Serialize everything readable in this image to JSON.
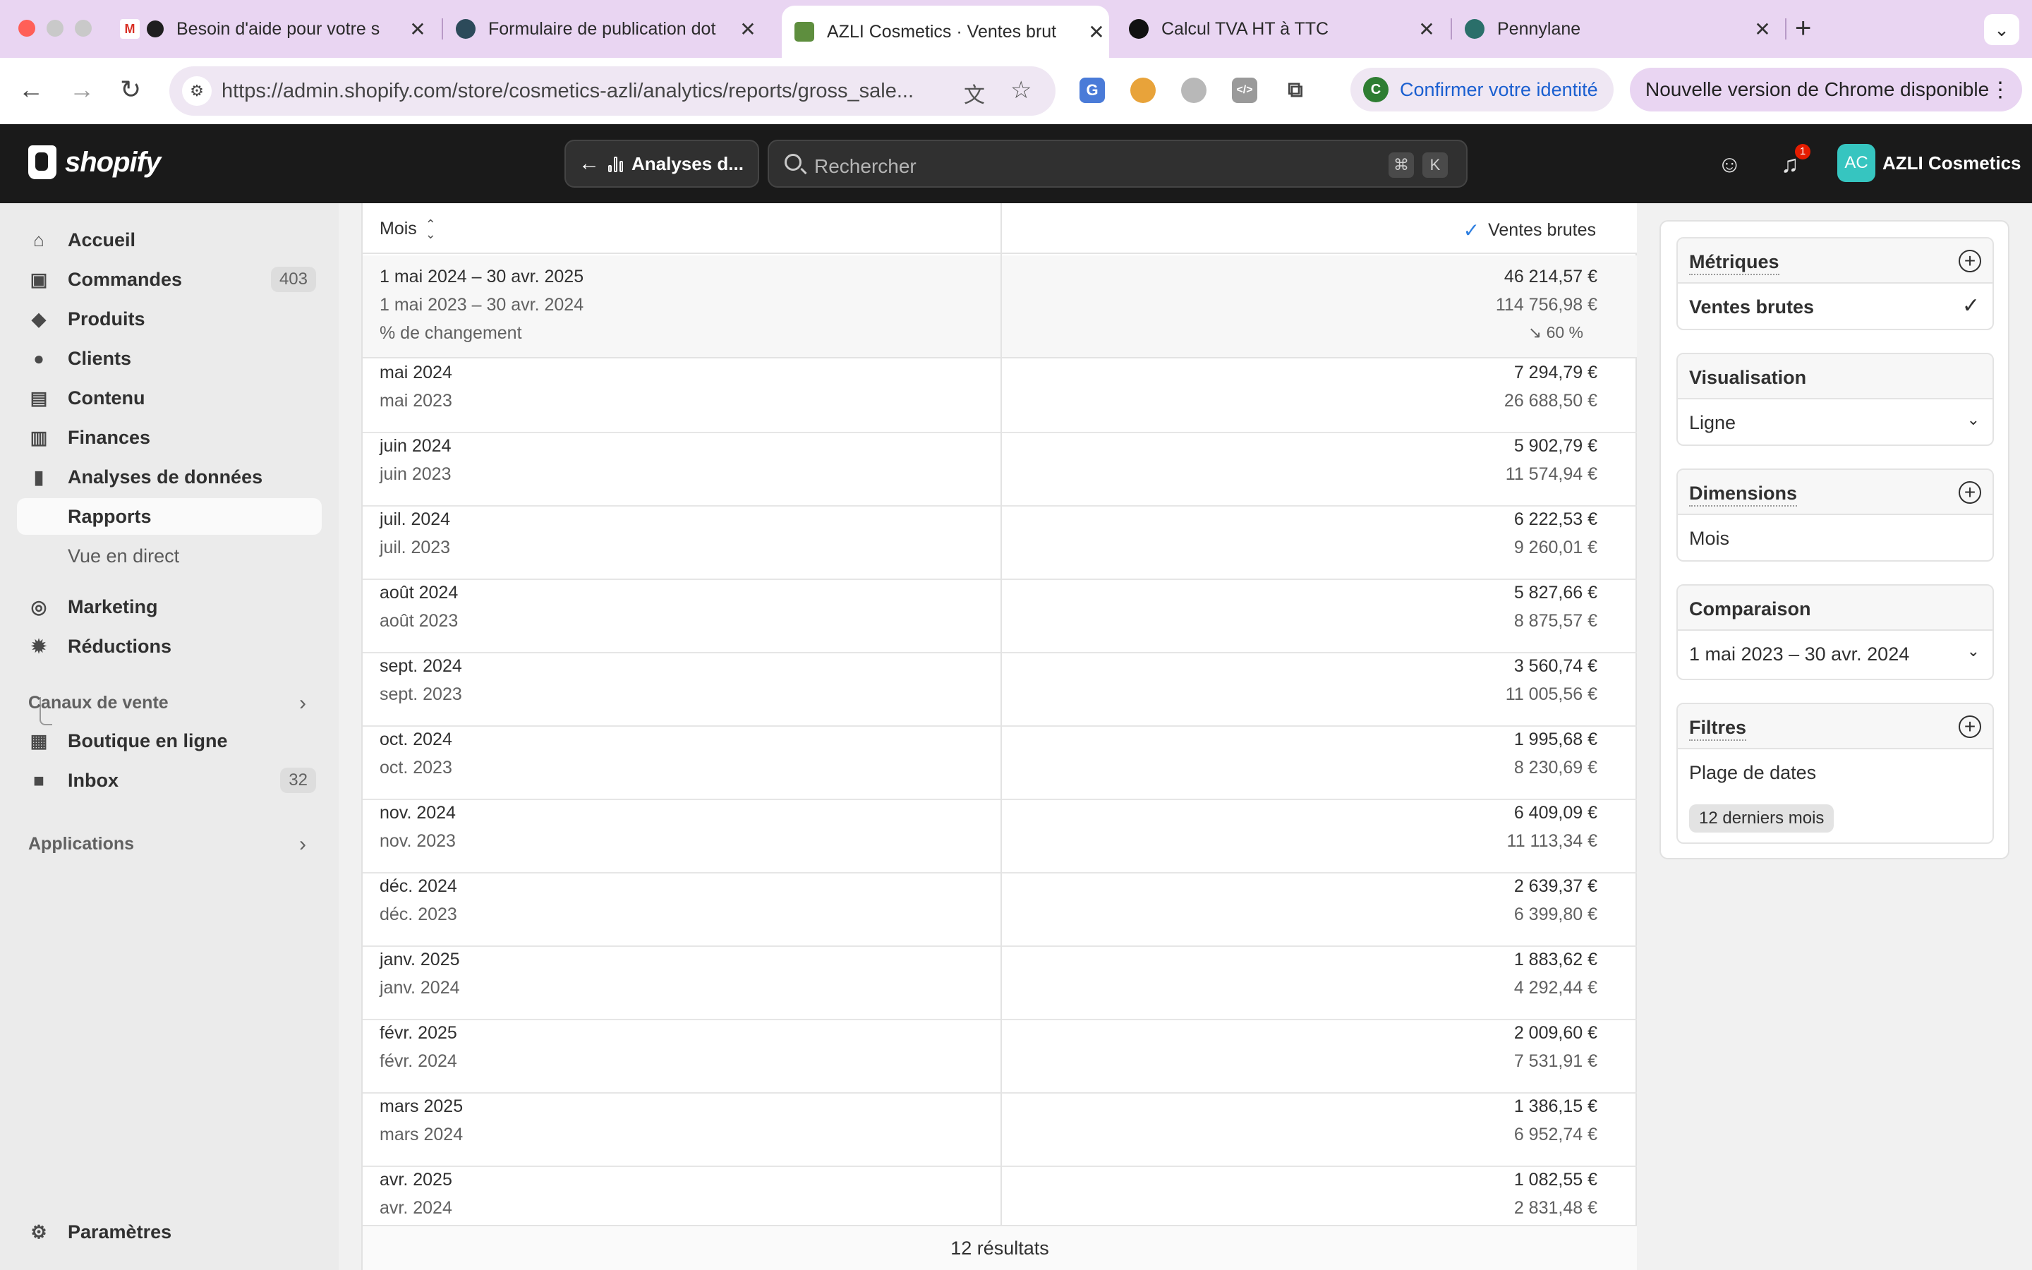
{
  "browser": {
    "tabs": [
      {
        "label": "Besoin d'aide pour votre s",
        "close": "✕"
      },
      {
        "label": "Formulaire de publication dot",
        "close": "✕"
      },
      {
        "label": "AZLI Cosmetics · Ventes brut",
        "close": "✕"
      },
      {
        "label": "Calcul TVA HT à TTC",
        "close": "✕"
      },
      {
        "label": "Pennylane",
        "close": "✕"
      }
    ],
    "new_tab": "+",
    "url": "https://admin.shopify.com/store/cosmetics-azli/analytics/reports/gross_sale...",
    "confirm_identity": "Confirmer votre identité",
    "update_notice": "Nouvelle version de Chrome disponible",
    "profile_initial": "C"
  },
  "shopify": {
    "logo_text": "shopify",
    "back_label": "Analyses d...",
    "search_placeholder": "Rechercher",
    "kbd_cmd": "⌘",
    "kbd_k": "K",
    "notification_count": "1",
    "avatar_initials": "AC",
    "store_name": "AZLI Cosmetics"
  },
  "sidebar": {
    "items": [
      {
        "label": "Accueil"
      },
      {
        "label": "Commandes",
        "count": "403"
      },
      {
        "label": "Produits"
      },
      {
        "label": "Clients"
      },
      {
        "label": "Contenu"
      },
      {
        "label": "Finances"
      },
      {
        "label": "Analyses de données"
      },
      {
        "label": "Rapports"
      },
      {
        "label": "Vue en direct"
      },
      {
        "label": "Marketing"
      },
      {
        "label": "Réductions"
      }
    ],
    "sales_channels_title": "Canaux de vente",
    "channels": [
      {
        "label": "Boutique en ligne"
      },
      {
        "label": "Inbox",
        "count": "32"
      }
    ],
    "apps_title": "Applications",
    "settings_label": "Paramètres"
  },
  "report": {
    "col_month": "Mois",
    "col_metric": "Ventes brutes",
    "summary": {
      "period_current": "1 mai 2024 – 30 avr. 2025",
      "period_previous": "1 mai 2023 – 30 avr. 2024",
      "change_label": "% de changement",
      "total_current": "46 214,57 €",
      "total_previous": "114 756,98 €",
      "change_value": "↘ 60 %"
    },
    "rows": [
      {
        "month": "mai 2024",
        "month_prev": "mai 2023",
        "value": "7 294,79 €",
        "value_prev": "26 688,50 €"
      },
      {
        "month": "juin 2024",
        "month_prev": "juin 2023",
        "value": "5 902,79 €",
        "value_prev": "11 574,94 €"
      },
      {
        "month": "juil. 2024",
        "month_prev": "juil. 2023",
        "value": "6 222,53 €",
        "value_prev": "9 260,01 €"
      },
      {
        "month": "août 2024",
        "month_prev": "août 2023",
        "value": "5 827,66 €",
        "value_prev": "8 875,57 €"
      },
      {
        "month": "sept. 2024",
        "month_prev": "sept. 2023",
        "value": "3 560,74 €",
        "value_prev": "11 005,56 €"
      },
      {
        "month": "oct. 2024",
        "month_prev": "oct. 2023",
        "value": "1 995,68 €",
        "value_prev": "8 230,69 €"
      },
      {
        "month": "nov. 2024",
        "month_prev": "nov. 2023",
        "value": "6 409,09 €",
        "value_prev": "11 113,34 €"
      },
      {
        "month": "déc. 2024",
        "month_prev": "déc. 2023",
        "value": "2 639,37 €",
        "value_prev": "6 399,80 €"
      },
      {
        "month": "janv. 2025",
        "month_prev": "janv. 2024",
        "value": "1 883,62 €",
        "value_prev": "4 292,44 €"
      },
      {
        "month": "févr. 2025",
        "month_prev": "févr. 2024",
        "value": "2 009,60 €",
        "value_prev": "7 531,91 €"
      },
      {
        "month": "mars 2025",
        "month_prev": "mars 2024",
        "value": "1 386,15 €",
        "value_prev": "6 952,74 €"
      },
      {
        "month": "avr. 2025",
        "month_prev": "avr. 2024",
        "value": "1 082,55 €",
        "value_prev": "2 831,48 €"
      }
    ],
    "footer": "12 résultats"
  },
  "panel": {
    "metrics_title": "Métriques",
    "metric_value": "Ventes brutes",
    "visualization_title": "Visualisation",
    "visualization_value": "Ligne",
    "dimensions_title": "Dimensions",
    "dimension_value": "Mois",
    "comparison_title": "Comparaison",
    "comparison_value": "1 mai 2023 – 30 avr. 2024",
    "filters_title": "Filtres",
    "filter_label": "Plage de dates",
    "filter_chip": "12 derniers mois"
  },
  "colors": {
    "tabstrip": "#e9d5f2",
    "shopify_bar": "#1a1a1a",
    "accent_check": "#2f7fe0",
    "avatar": "#36c5c0"
  }
}
